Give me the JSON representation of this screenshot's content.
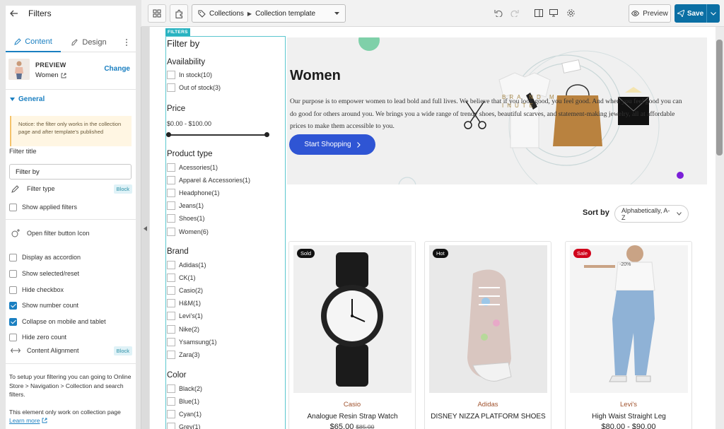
{
  "panel": {
    "title": "Filters",
    "tabs": {
      "content": "Content",
      "design": "Design"
    },
    "preview": {
      "label": "PREVIEW",
      "value": "Women",
      "change": "Change"
    },
    "section": "General",
    "notice": "Notice: the filter only works in the collection page and after template's published",
    "filter_title_label": "Filter title",
    "filter_title_value": "Filter by",
    "filter_type": {
      "label": "Filter type",
      "badge": "Block"
    },
    "show_applied": "Show applied filters",
    "open_filter_icon": "Open filter button Icon",
    "options": [
      {
        "label": "Display as accordion",
        "checked": false
      },
      {
        "label": "Show selected/reset",
        "checked": false
      },
      {
        "label": "Hide checkbox",
        "checked": false
      },
      {
        "label": "Show number count",
        "checked": true
      },
      {
        "label": "Collapse on mobile and tablet",
        "checked": true
      },
      {
        "label": "Hide zero count",
        "checked": false
      }
    ],
    "content_alignment": {
      "label": "Content Alignment",
      "badge": "Block"
    },
    "footer1": "To setup your filtering you can going to Online Store > Navigation > Collection and search filters.",
    "footer2": "This element only work on collection page",
    "learn_more": "Learn more"
  },
  "toolbar": {
    "collection": "Collections",
    "template": "Collection template",
    "preview": "Preview",
    "save": "Save"
  },
  "filters": {
    "tag": "FILTERS",
    "title": "Filter by",
    "availability": {
      "title": "Availability",
      "items": [
        "In stock(10)",
        "Out of stock(3)"
      ]
    },
    "price": {
      "title": "Price",
      "range": "$0.00 - $100.00",
      "min_fraction": 0,
      "max_fraction": 1
    },
    "product_type": {
      "title": "Product type",
      "items": [
        "Acessories(1)",
        "Apparel & Accessories(1)",
        "Headphone(1)",
        "Jeans(1)",
        "Shoes(1)",
        "Women(6)"
      ]
    },
    "brand": {
      "title": "Brand",
      "items": [
        "Adidas(1)",
        "CK(1)",
        "Casio(2)",
        "H&M(1)",
        "Levi's(1)",
        "Nike(2)",
        "Ysamsung(1)",
        "Zara(3)"
      ]
    },
    "color": {
      "title": "Color",
      "items": [
        "Black(2)",
        "Blue(1)",
        "Cyan(1)",
        "Grey(1)"
      ]
    }
  },
  "hero": {
    "title": "Women",
    "text": "Our purpose is to empower women to lead bold and full lives. We believe that if you look good, you feel good. And when you feel good you can do good for others around you. We brings you a wide range of trendy shoes, beautiful scarves, and statement-making jewelry, all at affordable prices to make them accessible to you.",
    "button": "Start Shopping",
    "bag_text": "BRA ND M INUTE",
    "accent_color": "#2f55d4"
  },
  "sort": {
    "label": "Sort by",
    "value": "Alphabetically, A-Z"
  },
  "products": [
    {
      "tag": "Sold",
      "tag_color": "#111111",
      "brand": "Casio",
      "name": "Analogue Resin Strap Watch",
      "price": "$65.00",
      "old_price": "$85.00"
    },
    {
      "tag": "Hot",
      "tag_color": "#111111",
      "brand": "Adidas",
      "name": "DISNEY NIZZA PLATFORM SHOES",
      "price": "",
      "old_price": ""
    },
    {
      "tag": "Sale",
      "tag_color": "#d0021b",
      "brand": "Levi's",
      "name": "High Waist Straight Leg",
      "price": "$80.00 - $90.00",
      "old_price": "",
      "badge_text": "-20%"
    }
  ]
}
